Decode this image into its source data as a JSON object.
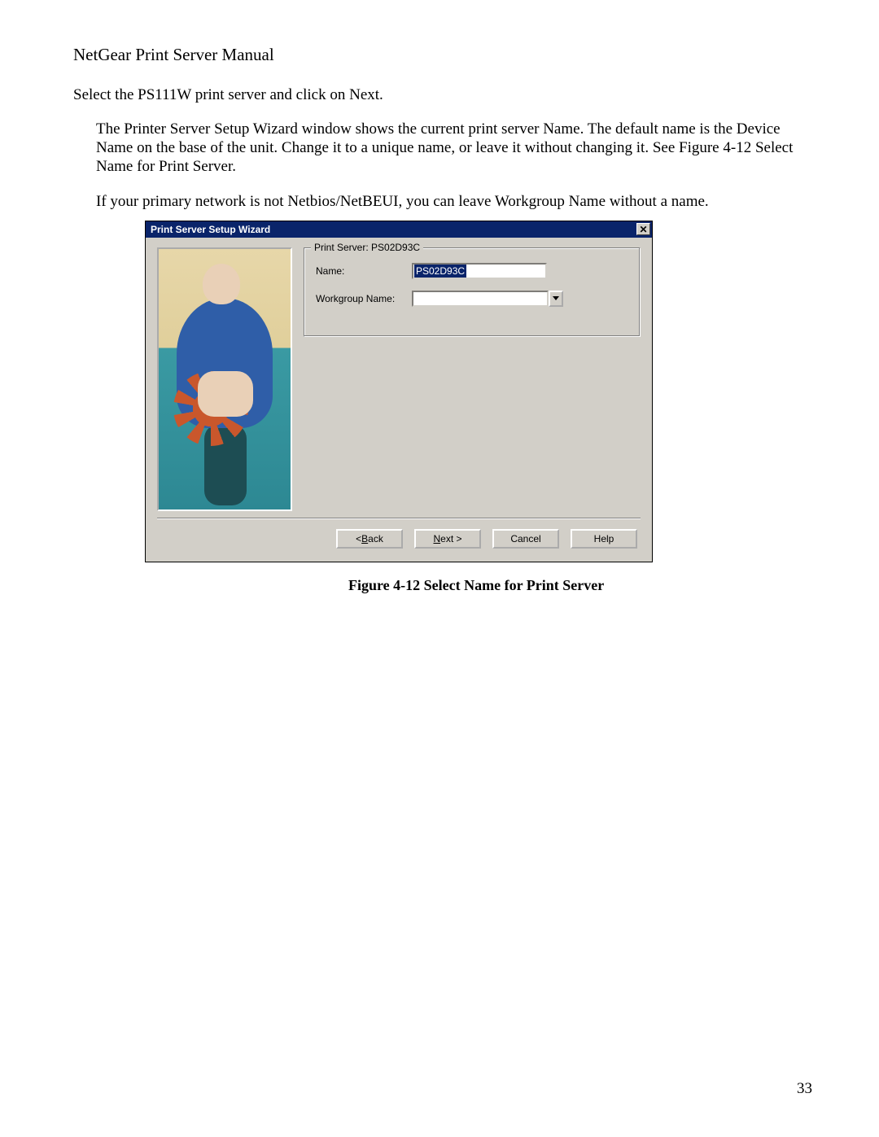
{
  "doc_title": "NetGear Print Server Manual",
  "section_heading": "Select the PS111W print server and click on Next.",
  "paragraph_1": "The Printer Server Setup Wizard window shows the current print server Name. The default name is the Device Name on the base of the unit. Change it to a unique name, or leave it without changing it. See Figure 4-12 Select Name for Print Server.",
  "paragraph_2": "If your primary network is not Netbios/NetBEUI, you can leave Workgroup Name without a name.",
  "dialog": {
    "title": "Print Server Setup Wizard",
    "close_glyph": "✕",
    "groupbox_legend": "Print Server: PS02D93C",
    "name_label": "Name:",
    "name_value": "PS02D93C",
    "workgroup_label": "Workgroup Name:",
    "workgroup_value": "",
    "buttons": {
      "back_prefix": "< ",
      "back_ul": "B",
      "back_suffix": "ack",
      "next_ul": "N",
      "next_suffix": "ext >",
      "cancel": "Cancel",
      "help": "Help"
    }
  },
  "figure_caption": "Figure 4-12 Select Name for Print Server",
  "page_number": "33"
}
